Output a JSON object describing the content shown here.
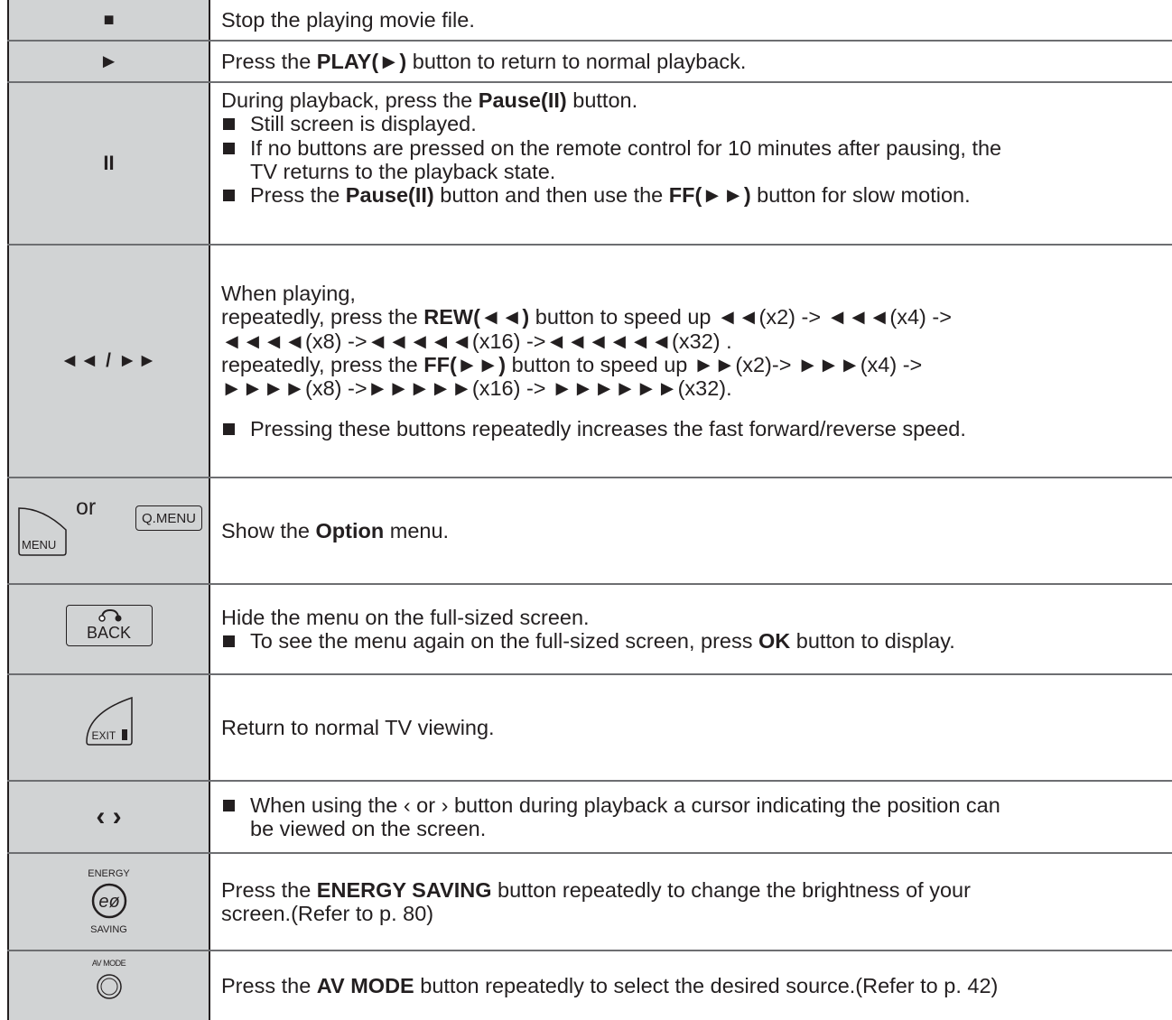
{
  "rows": [
    {
      "key_label": "■",
      "text": "Stop the playing movie file."
    },
    {
      "key_label": "►",
      "pre": "Press the ",
      "bold": "PLAY(►)",
      "post": " button to return to normal playback."
    },
    {
      "key_label": "II",
      "intro_pre": "During playback, press the ",
      "intro_bold": "Pause(II)",
      "intro_post": " button.",
      "bullet1": "Still screen is displayed.",
      "bullet2_line1": "If no buttons are pressed on the remote control for 10 minutes after pausing, the",
      "bullet2_line2": "TV returns to the playback state.",
      "bullet3_pre": "Press the ",
      "bullet3_bold1": "Pause(II)",
      "bullet3_mid": " button and then use the ",
      "bullet3_bold2": "FF(►►)",
      "bullet3_post": " button for slow motion."
    },
    {
      "key_label": "◄◄ / ►►",
      "line1": "When playing,",
      "rew_pre": "repeatedly, press the ",
      "rew_bold": "REW(◄◄)",
      "rew_post": " button to speed up ◄◄(x2) -> ◄◄◄(x4) ->",
      "rew_line2": "◄◄◄◄(x8) ->◄◄◄◄◄(x16) ->◄◄◄◄◄◄(x32) .",
      "ff_pre": "repeatedly, press the ",
      "ff_bold": "FF(►►)",
      "ff_post": " button to speed up ►►(x2)-> ►►►(x4) ->",
      "ff_line2": "►►►►(x8) ->►►►►►(x16) -> ►►►►►►(x32).",
      "bullet": "Pressing these buttons repeatedly increases the fast forward/reverse speed."
    },
    {
      "menu_label": "MENU",
      "or_label": "or",
      "qmenu_label": "Q.MENU",
      "pre": "Show the ",
      "bold": "Option",
      "post": " menu."
    },
    {
      "back_label": "BACK",
      "line1": "Hide the menu on the full-sized screen.",
      "bullet_pre": "To see the menu again on the full-sized screen, press ",
      "bullet_bold": "OK",
      "bullet_post": " button to display."
    },
    {
      "exit_label": "EXIT",
      "text": "Return to normal TV viewing."
    },
    {
      "key_label": "‹ ›",
      "line1": "When using the ‹ or › button during playback a cursor indicating the position can",
      "line2": "be viewed on the screen."
    },
    {
      "energy_top": "ENERGY",
      "energy_bottom": "SAVING",
      "energy_icon": "eco-leaf-icon",
      "pre": "Press the ",
      "bold": "ENERGY SAVING",
      "post": " button repeatedly to change the brightness of your",
      "line2": "screen.(Refer to p. 80)"
    },
    {
      "avmode_label": "AV MODE",
      "pre": "Press the ",
      "bold": "AV MODE",
      "post": " button repeatedly to select the desired source.(Refer to p. 42)"
    }
  ],
  "colors": {
    "key_bg": "#d1d3d4",
    "border": "#231f20",
    "text": "#231f20"
  }
}
